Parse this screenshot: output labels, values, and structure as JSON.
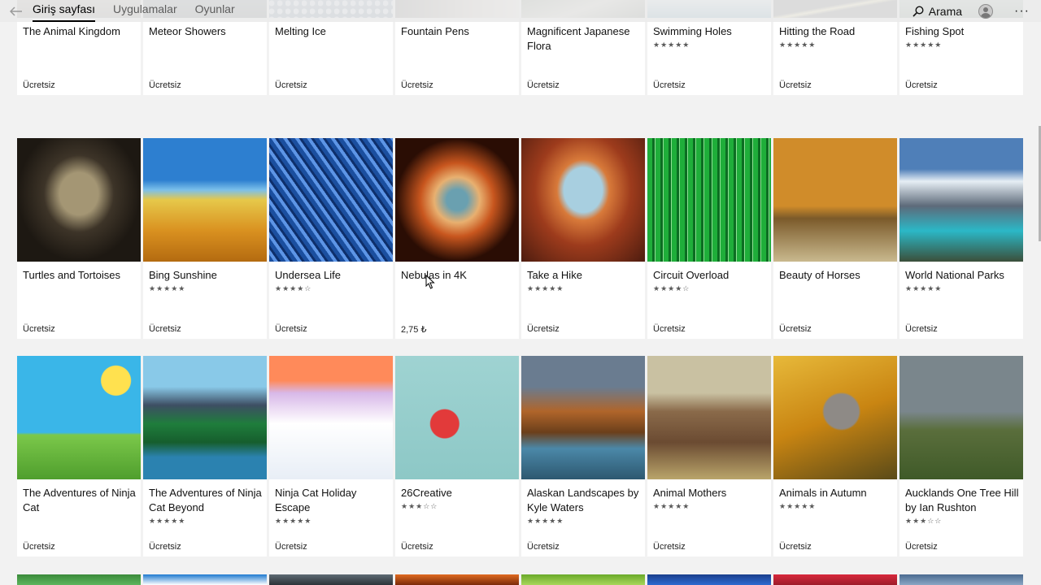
{
  "nav": {
    "back_icon": "back-arrow-icon",
    "tabs": [
      "Giriş sayfası",
      "Uygulamalar",
      "Oyunlar"
    ],
    "active_tab": 0,
    "search_label": "Arama",
    "more_label": "···"
  },
  "rows": [
    [
      {
        "title": "The Animal Kingdom",
        "stars": "",
        "price": "Ücretsiz"
      },
      {
        "title": "Meteor Showers",
        "stars": "",
        "price": "Ücretsiz"
      },
      {
        "title": "Melting Ice",
        "stars": "",
        "price": "Ücretsiz"
      },
      {
        "title": "Fountain Pens",
        "stars": "",
        "price": "Ücretsiz"
      },
      {
        "title": "Magnificent Japanese Flora",
        "stars": "",
        "price": "Ücretsiz"
      },
      {
        "title": "Swimming Holes",
        "stars": "★★★★★",
        "price": "Ücretsiz"
      },
      {
        "title": "Hitting the Road",
        "stars": "★★★★★",
        "price": "Ücretsiz"
      },
      {
        "title": "Fishing Spot",
        "stars": "★★★★★",
        "price": "Ücretsiz"
      }
    ],
    [
      {
        "title": "Turtles and Tortoises",
        "stars": "",
        "price": "Ücretsiz"
      },
      {
        "title": "Bing Sunshine",
        "stars": "★★★★★",
        "price": "Ücretsiz"
      },
      {
        "title": "Undersea Life",
        "stars": "★★★★☆",
        "price": "Ücretsiz"
      },
      {
        "title": "Nebulas in 4K",
        "stars": "",
        "price": "2,75 ₺"
      },
      {
        "title": "Take a Hike",
        "stars": "★★★★★",
        "price": "Ücretsiz"
      },
      {
        "title": "Circuit Overload",
        "stars": "★★★★☆",
        "price": "Ücretsiz"
      },
      {
        "title": "Beauty of Horses",
        "stars": "",
        "price": "Ücretsiz"
      },
      {
        "title": "World National Parks",
        "stars": "★★★★★",
        "price": "Ücretsiz"
      }
    ],
    [
      {
        "title": "The Adventures of Ninja Cat",
        "stars": "",
        "price": "Ücretsiz"
      },
      {
        "title": "The Adventures of Ninja Cat Beyond",
        "stars": "★★★★★",
        "price": "Ücretsiz"
      },
      {
        "title": "Ninja Cat Holiday Escape",
        "stars": "★★★★★",
        "price": "Ücretsiz"
      },
      {
        "title": "26Creative",
        "stars": "★★★☆☆",
        "price": "Ücretsiz"
      },
      {
        "title": "Alaskan Landscapes by Kyle Waters",
        "stars": "★★★★★",
        "price": "Ücretsiz"
      },
      {
        "title": "Animal Mothers",
        "stars": "★★★★★",
        "price": "Ücretsiz"
      },
      {
        "title": "Animals in Autumn",
        "stars": "★★★★★",
        "price": "Ücretsiz"
      },
      {
        "title": "Aucklands One Tree Hill by Ian Rushton",
        "stars": "★★★☆☆",
        "price": "Ücretsiz"
      }
    ]
  ],
  "bottom_row_icons": [
    "landscape-thumbnail-icon",
    "sky-thumbnail-icon",
    "clouds-thumbnail-icon",
    "sunset-thumbnail-icon",
    "forest-thumbnail-icon",
    "ocean-thumbnail-icon",
    "red-thumbnail-icon",
    "mountain-thumbnail-icon"
  ]
}
